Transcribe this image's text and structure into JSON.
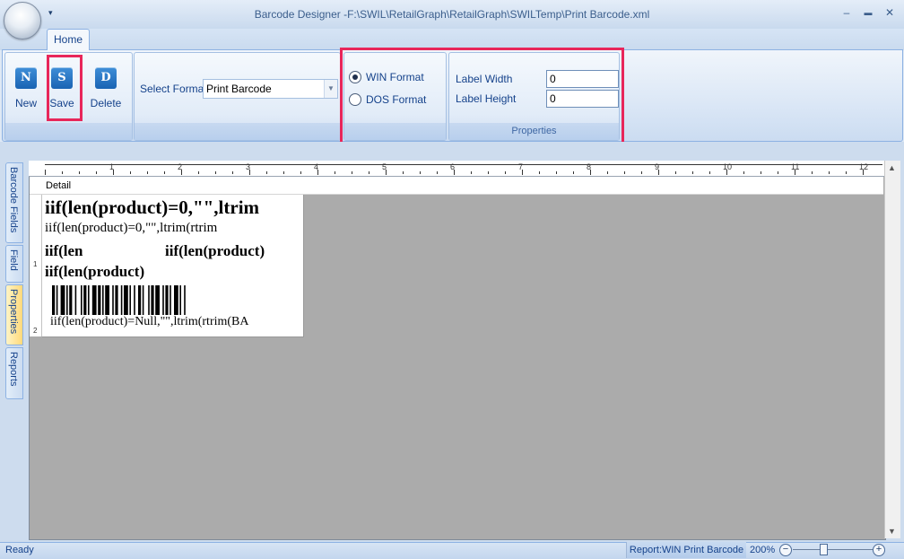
{
  "window": {
    "title": "Barcode Designer -F:\\SWIL\\RetailGraph\\RetailGraph\\SWILTemp\\Print Barcode.xml",
    "qat_glyph": "▾",
    "minimize": "–",
    "restore": "▬",
    "close": "✕"
  },
  "ribbon": {
    "tab_home": "Home",
    "buttons": {
      "new": {
        "label": "New",
        "icon_text": "N"
      },
      "save": {
        "label": "Save",
        "icon_text": "S"
      },
      "delete": {
        "label": "Delete",
        "icon_text": "D"
      }
    },
    "select_format_label": "Select Format",
    "select_format_value": "Print Barcode",
    "win_format": "WIN Format",
    "dos_format": "DOS Format",
    "win_format_selected": true,
    "label_width_label": "Label Width",
    "label_width_value": "0",
    "label_height_label": "Label Height",
    "label_height_value": "0",
    "properties_caption": "Properties"
  },
  "side_tabs": [
    "Barcode Fields",
    "Field",
    "Properties",
    "Reports"
  ],
  "designer": {
    "ruler_numbers": [
      "1",
      "2",
      "3",
      "4",
      "5",
      "6",
      "7",
      "8",
      "9",
      "10",
      "11",
      "12"
    ],
    "vruler_numbers": [
      "1",
      "2"
    ],
    "band": "Detail",
    "label_lines": {
      "line1": "iif(len(product)=0,\"\",ltrim",
      "line2": "iif(len(product)=0,\"\",ltrim(rtrim",
      "line3a": "iif(len",
      "line3b": "iif(len(product)",
      "line4": "iif(len(product)",
      "line5": "iif(len(product)=Null,\"\",ltrim(rtrim(BA"
    }
  },
  "status": {
    "ready": "Ready",
    "report": "Report:WIN Print Barcode",
    "zoom": "200%",
    "zoom_minus": "−",
    "zoom_plus": "+"
  },
  "colors": {
    "highlight": "#e8265a",
    "ribbon_text": "#15428b"
  }
}
